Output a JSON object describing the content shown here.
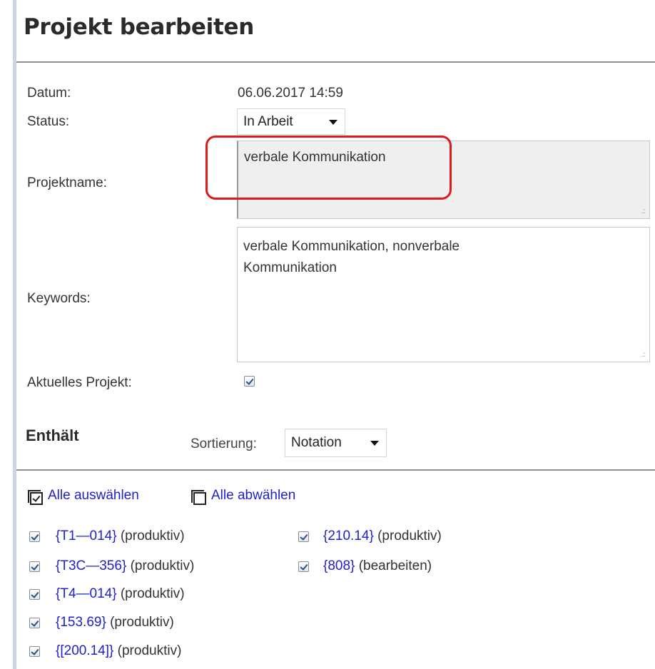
{
  "page": {
    "title": "Projekt bearbeiten"
  },
  "form": {
    "date_label": "Datum:",
    "date_value": "06.06.2017 14:59",
    "status_label": "Status:",
    "status_value": "In Arbeit",
    "project_name_label": "Projektname:",
    "project_name_value": "verbale Kommunikation",
    "keywords_label": "Keywords:",
    "keywords_line1": "verbale Kommunikation, nonverbale",
    "keywords_line2": "Kommunikation",
    "current_project_label": "Aktuelles Projekt:",
    "current_project_checked": true
  },
  "contains": {
    "title": "Enthält",
    "sort_label": "Sortierung:",
    "sort_value": "Notation",
    "select_all": "Alle auswählen",
    "deselect_all": "Alle abwählen",
    "items": [
      {
        "code": "{T1—014}",
        "status": "(produktiv)",
        "checked": true
      },
      {
        "code": "{T3C—356}",
        "status": "(produktiv)",
        "checked": true
      },
      {
        "code": "{T4—014}",
        "status": "(produktiv)",
        "checked": true
      },
      {
        "code": "{153.69}",
        "status": "(produktiv)",
        "checked": true
      },
      {
        "code": "{[200.14]}",
        "status": "(produktiv)",
        "checked": true
      },
      {
        "code": "{210.14}",
        "status": "(produktiv)",
        "checked": true
      },
      {
        "code": "{808}",
        "status": "(bearbeiten)",
        "checked": true
      }
    ]
  },
  "colors": {
    "link": "#2020cc",
    "highlight": "#e0191d",
    "accent_bar": "#c9d6e6"
  }
}
